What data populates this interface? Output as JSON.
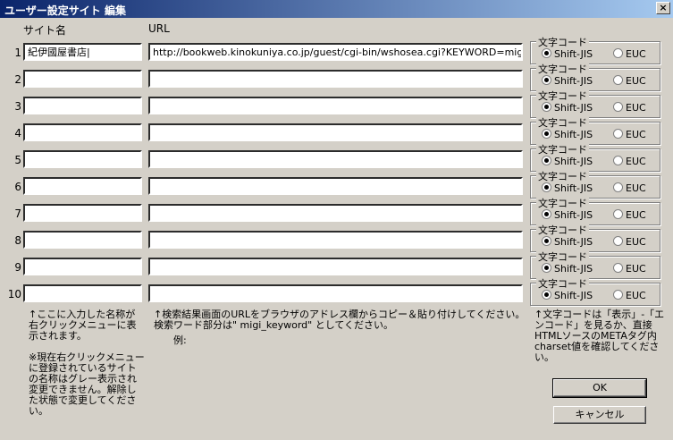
{
  "window": {
    "title": "ユーザー設定サイト 編集",
    "close_label": "×"
  },
  "headers": {
    "site_name": "サイト名",
    "url": "URL"
  },
  "encoding": {
    "legend": "文字コード",
    "option1": "Shift-JIS",
    "option2": "EUC"
  },
  "rows": [
    {
      "num": "1",
      "name": "紀伊國屋書店|",
      "url": "http://bookweb.kinokuniya.co.jp/guest/cgi-bin/wshosea.cgi?KEYWORD=migi_key",
      "encoding": "Shift-JIS"
    },
    {
      "num": "2",
      "name": "",
      "url": "",
      "encoding": "Shift-JIS"
    },
    {
      "num": "3",
      "name": "",
      "url": "",
      "encoding": "Shift-JIS"
    },
    {
      "num": "4",
      "name": "",
      "url": "",
      "encoding": "Shift-JIS"
    },
    {
      "num": "5",
      "name": "",
      "url": "",
      "encoding": "Shift-JIS"
    },
    {
      "num": "6",
      "name": "",
      "url": "",
      "encoding": "Shift-JIS"
    },
    {
      "num": "7",
      "name": "",
      "url": "",
      "encoding": "Shift-JIS"
    },
    {
      "num": "8",
      "name": "",
      "url": "",
      "encoding": "Shift-JIS"
    },
    {
      "num": "9",
      "name": "",
      "url": "",
      "encoding": "Shift-JIS"
    },
    {
      "num": "10",
      "name": "",
      "url": "",
      "encoding": "Shift-JIS"
    }
  ],
  "notes": {
    "name_note": "↑ここに入力した名称が右クリックメニューに表示されます。",
    "gray_note": "※現在右クリックメニューに登録されているサイトの名称はグレー表示され変更できません。解除した状態で変更してください。",
    "url_note1": "↑検索結果画面のURLをブラウザのアドレス欄からコピー＆貼り付けしてください。",
    "url_note2": "検索ワード部分は\" migi_keyword\" としてください。",
    "example_label": "例:",
    "encoding_note": "↑文字コードは「表示」-「エンコード」を見るか、直接HTMLソースのMETAタグ内charset値を確認してください。"
  },
  "buttons": {
    "ok": "OK",
    "cancel": "キャンセル"
  }
}
